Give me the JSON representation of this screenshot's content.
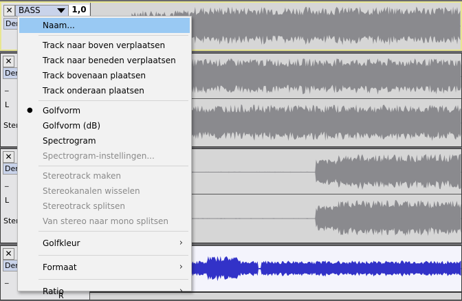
{
  "tracks": [
    {
      "close": "✕",
      "name": "BASS",
      "gain": "1,0",
      "mute": "Dempen",
      "selected": true,
      "color": "#8a8a8e"
    },
    {
      "close": "✕",
      "mute": "Dempen",
      "pan_left": "L",
      "stereo": "Stereo",
      "color": "#8a8a8e"
    },
    {
      "close": "✕",
      "mute": "Dempen",
      "pan_left": "L",
      "stereo": "Stereo",
      "color": "#8a8a8e"
    },
    {
      "close": "✕",
      "mute": "Dempen",
      "pan_right": "R",
      "color": "#3232c8"
    }
  ],
  "menu": {
    "items": [
      {
        "label": "Naam..."
      },
      {
        "label": "Track naar boven verplaatsen"
      },
      {
        "label": "Track naar beneden verplaatsen"
      },
      {
        "label": "Track bovenaan plaatsen"
      },
      {
        "label": "Track onderaan plaatsen"
      },
      {
        "label": "Golfvorm",
        "checked": "●"
      },
      {
        "label": "Golfvorm (dB)"
      },
      {
        "label": "Spectrogram"
      },
      {
        "label": "Spectrogram-instellingen..."
      },
      {
        "label": "Stereotrack maken"
      },
      {
        "label": "Stereokanalen wisselen"
      },
      {
        "label": "Stereotrack splitsen"
      },
      {
        "label": "Van stereo naar mono splitsen"
      },
      {
        "label": "Golfkleur",
        "arrow": "›"
      },
      {
        "label": "Formaat",
        "arrow": "›"
      },
      {
        "label": "Ratio",
        "arrow": "›"
      }
    ]
  }
}
